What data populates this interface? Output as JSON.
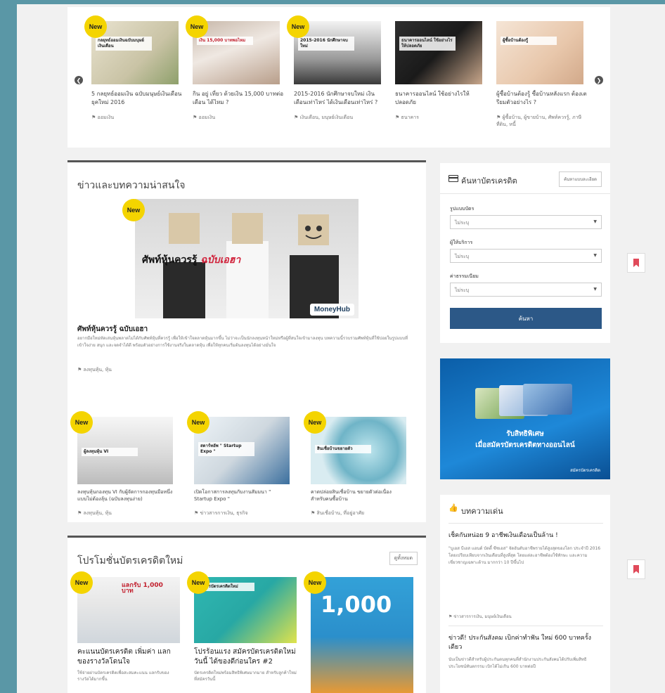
{
  "badge": "New",
  "slider": {
    "items": [
      {
        "title": "5 กลยุทธ์ออมเงิน ฉบับมนุษย์เงินเดือนยุคใหม่ 2016",
        "tag": "ออมเงิน",
        "caption": "กลยุทธ์ออมเงินฉบับมนุษย์เงินเดือน"
      },
      {
        "title": "กิน อยู่ เที่ยว ด้วยเงิน 15,000 บาทต่อเดือน ได้ไหม ?",
        "tag": "ออมเงิน",
        "caption": "เงิน 15,000 บาทพอไหม"
      },
      {
        "title": "2015-2016 นักศึกษาจบใหม่ เงินเดือนเท่าไหร่ ได้เงินเดือนเท่าไหร่ ?",
        "tag": "เงินเดือน, มนุษย์เงินเดือน",
        "caption": "2015-2016 นักศึกษาจบใหม่"
      },
      {
        "title": "ธนาคารออนไลน์ ใช้อย่างไรให้ปลอดภัย",
        "tag": "ธนาคาร",
        "caption": "ธนาคารออนไลน์ ใช้อย่างไรให้ปลอดภัย"
      },
      {
        "title": "ผู้ซื้อบ้านต้องรู้ ซื้อบ้านหลังแรก ต้องเตรียมตัวอย่างไร ?",
        "tag": "ผู้ซื้อบ้าน, ผู้ขายบ้าน, ศัพท์ควรรู้, ภาษีที่ดิน, หนี้",
        "caption": "ผู้ซื้อบ้านต้องรู้"
      }
    ]
  },
  "news": {
    "title": "ข่าวและบทความน่าสนใจ",
    "hero": {
      "caption_main": "ศัพท์หุ้นควรรู้",
      "caption_accent": "ฉบับเอฮา",
      "logo": "MoneyHub",
      "title": "ศัพท์หุ้นควรรู้ ฉบับเอฮา",
      "desc": "อยากมือใหม่หัดเล่นหุ้นพลาดไม่ได้กับศัพท์หุ้นที่ควรรู้ เพื่อให้เข้าใจตลาดหุ้นมากขึ้น ไม่ว่าจะเป็นนักลงทุนหน้าใหม่หรือผู้ที่สนใจเข้ามาลงทุน บทความนี้รวบรวมศัพท์หุ้นที่ใช้บ่อยในรูปแบบที่เข้าใจง่าย สนุก และจดจำได้ดี พร้อมตัวอย่างการใช้งานจริงในตลาดหุ้น เพื่อให้ทุกคนเริ่มต้นลงทุนได้อย่างมั่นใจ",
      "tag": "ลงทุนหุ้น, หุ้น"
    },
    "items": [
      {
        "title": "ลงทุนหุ้นกองทุน VI กับผู้จัดการกองทุนมือหนึ่ง แบบไม่ต้องลุ้น (ฉบับลงทุนง่าย)",
        "tag": "ลงทุนหุ้น, หุ้น",
        "caption": "ผู้ลงทุนหุ้น VI"
      },
      {
        "title": "เปิดโอกาสการลงทุนกับงานสัมมนา \" Startup Expo \"",
        "tag": "ข่าวสารการเงิน, ธุรกิจ",
        "caption": "สตาร์ทอัพ \" Startup Expo \""
      },
      {
        "title": "คาดปล่อยสินเชื่อบ้าน ขยายตัวต่อเนื่อง สำหรับคนซื้อบ้าน",
        "tag": "สินเชื่อบ้าน, ที่อยู่อาศัย",
        "caption": "สินเชื่อบ้านขยายตัว"
      }
    ]
  },
  "promo": {
    "title": "โปรโมชั่นบัตรเครดิตใหม่",
    "all_label": "ดูทั้งหมด",
    "items": [
      {
        "title": "คะแนนบัตรเครดิต เพิ่มค่า แลกของรางวัลโดนใจ",
        "desc": "ใช้จ่ายผ่านบัตรเครดิตเพื่อสะสมคะแนน แลกรับของรางวัลได้มากขึ้น",
        "caption": "แลกรับ 1,000 บาท"
      },
      {
        "title": "โปรร้อนแรง สมัครบัตรเครดิตใหม่ วันนี้ ได้ของดีก่อนใคร #2",
        "desc": "บัตรเครดิตใหม่พร้อมสิทธิพิเศษมากมาย สำหรับลูกค้าใหม่ที่สมัครวันนี้",
        "caption": "สมัครบัตรเครดิตใหม่"
      },
      {
        "title": "",
        "desc": "",
        "caption": "1,000"
      }
    ]
  },
  "search": {
    "title": "ค้นหาบัตรเครดิต",
    "adv_label": "ค้นหาแบบละเอียด",
    "fields": [
      {
        "label": "รูปแบบบัตร",
        "value": "ไม่ระบุ"
      },
      {
        "label": "ผู้ให้บริการ",
        "value": "ไม่ระบุ"
      },
      {
        "label": "ค่าธรรมเนียม",
        "value": "ไม่ระบุ"
      }
    ],
    "button": "ค้นหา"
  },
  "banner": {
    "line1": "รับสิทธิพิเศษ",
    "line2": "เมื่อสมัครบัตรเครดิตทางออนไลน์",
    "footer": "สมัครบัตรเครดิต"
  },
  "articles": {
    "title": "บทความเด่น",
    "items": [
      {
        "title": "เช็คกันหน่อย 9 อาชีพเงินเดือนเป็นล้าน !",
        "desc": "\"บูเอส บีเฮส แอนด์ บัดดี้ ซีซเอส\" จัดอันดับอาชีพรายได้สูงสุดของโลก ประจำปี 2016 โดยเปรียบเทียบจากเงินเดือนที่สูงที่สุด โดยแต่ละอาชีพต้องใช้ทักษะ และความเชี่ยวชาญเฉพาะด้าน มากกว่า 10 ปีขึ้นไป",
        "tag": "ข่าวสารการเงิน, มนุษย์เงินเดือน"
      },
      {
        "title": "ข่าวดี! ประกันสังคม เบิกค่าทำฟัน ใหม่ 600 บาทครั้งเดียว",
        "desc": "นับเป็นข่าวดีสำหรับผู้ประกันตนทุกคนที่สำนักงานประกันสังคมได้ปรับเพิ่มสิทธิประโยชน์ทันตกรรม เบิกได้ไม่เกิน 600 บาทต่อปี",
        "tag": ""
      }
    ]
  },
  "colors": {
    "accent": "#2c5887",
    "badge": "#f4d400",
    "page_bg": "#5a97a6"
  }
}
